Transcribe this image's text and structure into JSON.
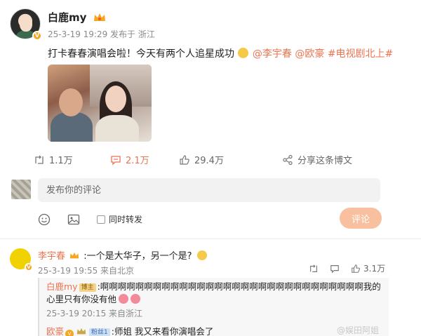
{
  "post": {
    "author": "白鹿my",
    "meta": "25-3-19 19:29 发布于 浙江",
    "text_line1": "打卡春春演唱会啦！今天有两个人追星成功",
    "text_line2_tags": [
      "@李宇春",
      "@欧豪",
      "#电视剧北上#"
    ],
    "badge": "V"
  },
  "actions": {
    "repost": "1.1万",
    "comment": "2.1万",
    "like": "29.4万",
    "share": "分享这条博文"
  },
  "composer": {
    "placeholder": "发布你的评论",
    "repost_label": "同时转发",
    "submit_label": "评论"
  },
  "comment": {
    "author": "李宇春",
    "text": ":一个是大华子，另一个是?",
    "meta": "25-3-19 19:55 来自北京",
    "likes": "3.1万",
    "replies": [
      {
        "author": "白鹿my",
        "badge": "博主",
        "text": ":啊啊啊啊啊啊啊啊啊啊啊啊啊啊啊啊啊啊啊啊啊啊啊啊啊啊啊啊啊啊我的心里只有你没有他",
        "meta": "25-3-19 20:15 来自浙江"
      },
      {
        "author": "欧豪",
        "badge": "粉丝1",
        "text": ":师姐 我又来看你演唱会了"
      }
    ]
  },
  "watermark": "@娱田阿姐",
  "colors": {
    "accent": "#eb7350",
    "muted": "#8a8a8a",
    "submit": "#f8c09e"
  }
}
